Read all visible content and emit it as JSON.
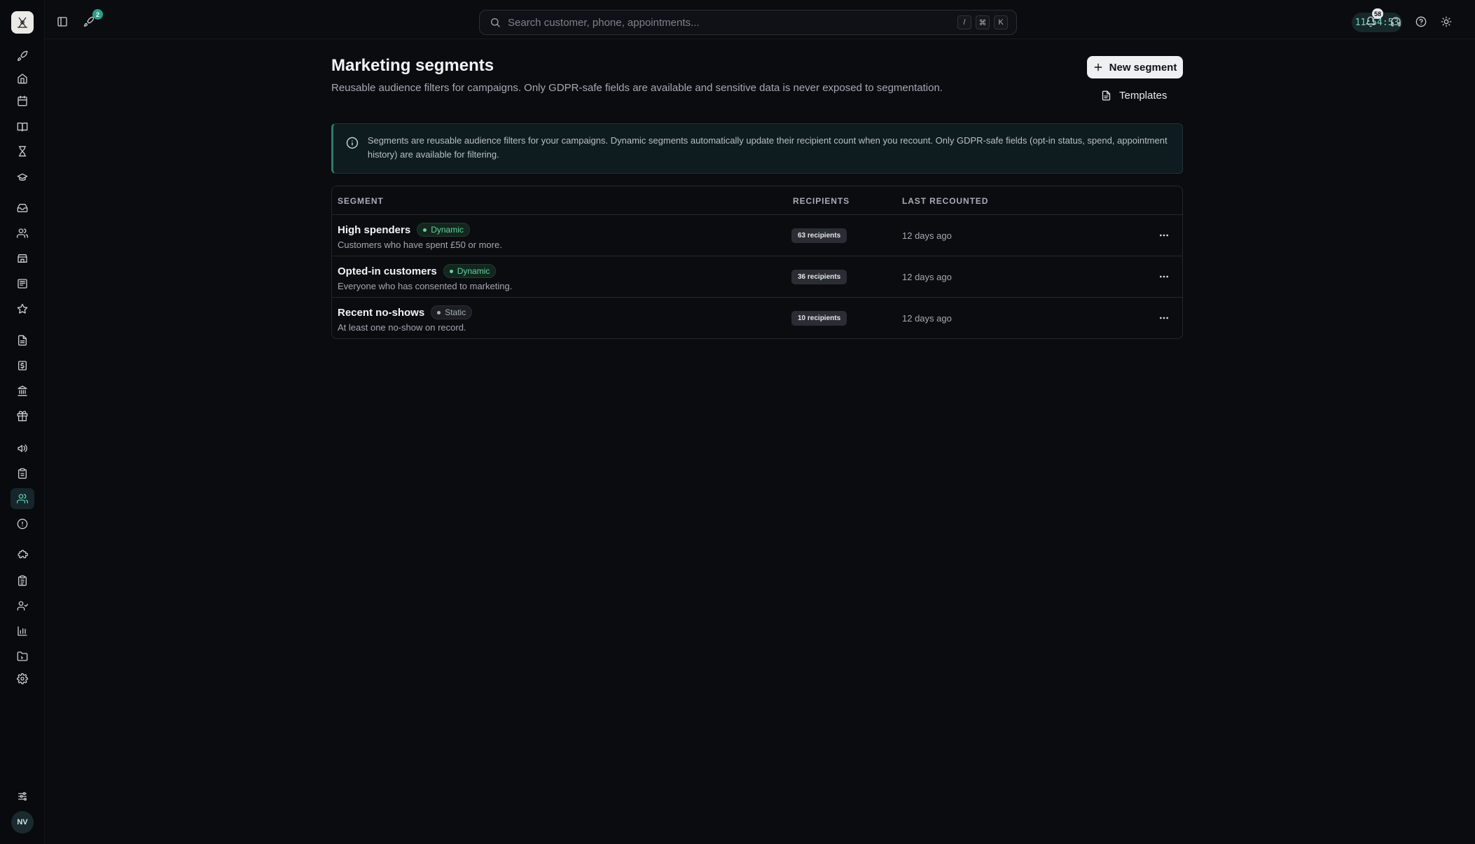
{
  "sidebar": {
    "items": [
      {
        "icon": "rocket-icon",
        "active": false
      },
      {
        "icon": "home-icon",
        "active": false
      },
      {
        "icon": "calendar-icon",
        "active": false
      },
      {
        "icon": "book-icon",
        "active": false
      },
      {
        "icon": "hourglass-icon",
        "active": false
      },
      {
        "icon": "graduation-cap-icon",
        "active": false
      },
      {
        "icon": "inbox-icon",
        "active": false
      },
      {
        "icon": "users-icon",
        "active": false
      },
      {
        "icon": "store-icon",
        "active": false
      },
      {
        "icon": "newspaper-icon",
        "active": false
      },
      {
        "icon": "star-icon",
        "active": false
      },
      {
        "icon": "file-text-icon",
        "active": false
      },
      {
        "icon": "receipt-icon",
        "active": false
      },
      {
        "icon": "bank-icon",
        "active": false
      },
      {
        "icon": "gift-icon",
        "active": false
      },
      {
        "icon": "megaphone-icon",
        "active": false
      },
      {
        "icon": "clipboard-icon",
        "active": false
      },
      {
        "icon": "segments-users-icon",
        "active": true
      },
      {
        "icon": "alert-circle-icon",
        "active": false
      },
      {
        "icon": "puzzle-icon",
        "active": false
      },
      {
        "icon": "clipboard-list-icon",
        "active": false
      },
      {
        "icon": "user-check-icon",
        "active": false
      },
      {
        "icon": "bar-chart-icon",
        "active": false
      },
      {
        "icon": "folder-icon",
        "active": false
      },
      {
        "icon": "settings-icon",
        "active": false
      }
    ],
    "footer_icon": "sliders-icon",
    "avatar_initials": "NV"
  },
  "topbar": {
    "rocket_badge": "2",
    "search_placeholder": "Search customer, phone, appointments...",
    "shortcut_keys": [
      "/",
      "⌘",
      "K"
    ],
    "clock": "11:54:53",
    "notifications_badge": "58"
  },
  "page": {
    "title": "Marketing segments",
    "subtitle": "Reusable audience filters for campaigns. Only GDPR-safe fields are available and sensitive data is never exposed to segmentation.",
    "new_segment_label": "New segment",
    "templates_label": "Templates"
  },
  "info": {
    "text": "Segments are reusable audience filters for your campaigns. Dynamic segments automatically update their recipient count when you recount. Only GDPR-safe fields (opt-in status, spend, appointment history) are available for filtering."
  },
  "table": {
    "headers": {
      "segment": "SEGMENT",
      "recipients": "RECIPIENTS",
      "last_recounted": "LAST RECOUNTED"
    },
    "rows": [
      {
        "name": "High spenders",
        "type": "Dynamic",
        "description": "Customers who have spent £50 or more.",
        "recipients": "63 recipients",
        "last_recounted": "12 days ago"
      },
      {
        "name": "Opted-in customers",
        "type": "Dynamic",
        "description": "Everyone who has consented to marketing.",
        "recipients": "36 recipients",
        "last_recounted": "12 days ago"
      },
      {
        "name": "Recent no-shows",
        "type": "Static",
        "description": "At least one no-show on record.",
        "recipients": "10 recipients",
        "last_recounted": "12 days ago"
      }
    ]
  },
  "colors": {
    "accent": "#4fd0b1",
    "dynamic_badge": "#5fd39a",
    "background": "#0b0c10"
  }
}
